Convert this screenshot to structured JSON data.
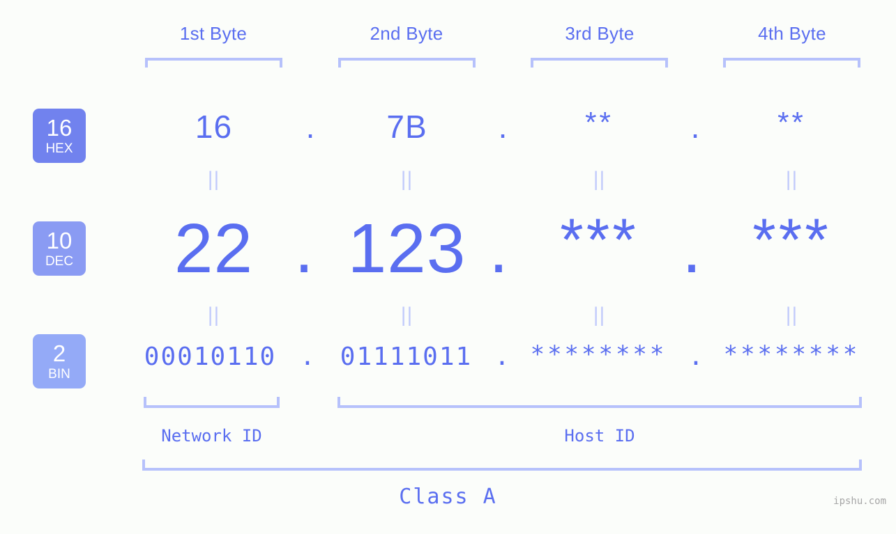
{
  "page": {
    "background_color": "#fbfdfa",
    "accent_color": "#5a6ef0",
    "bracket_color": "#b6c1fb",
    "separator_color": "#c2cbfb"
  },
  "byte_headers": [
    {
      "label": "1st Byte"
    },
    {
      "label": "2nd Byte"
    },
    {
      "label": "3rd Byte"
    },
    {
      "label": "4th Byte"
    }
  ],
  "bases": [
    {
      "num": "16",
      "name": "HEX",
      "color": "#7182ee"
    },
    {
      "num": "10",
      "name": "DEC",
      "color": "#8a9bf3"
    },
    {
      "num": "2",
      "name": "BIN",
      "color": "#94aaf7"
    }
  ],
  "rows": {
    "hex": {
      "octets": [
        "16",
        "7B",
        "**",
        "**"
      ],
      "separator": "."
    },
    "dec": {
      "octets": [
        "22",
        "123",
        "***",
        "***"
      ],
      "separator": "."
    },
    "bin": {
      "octets": [
        "00010110",
        "01111011",
        "********",
        "********"
      ],
      "separator": "."
    }
  },
  "equals_glyph": "||",
  "segments": {
    "network_id": "Network ID",
    "host_id": "Host ID"
  },
  "class_label": "Class A",
  "watermark": "ipshu.com"
}
